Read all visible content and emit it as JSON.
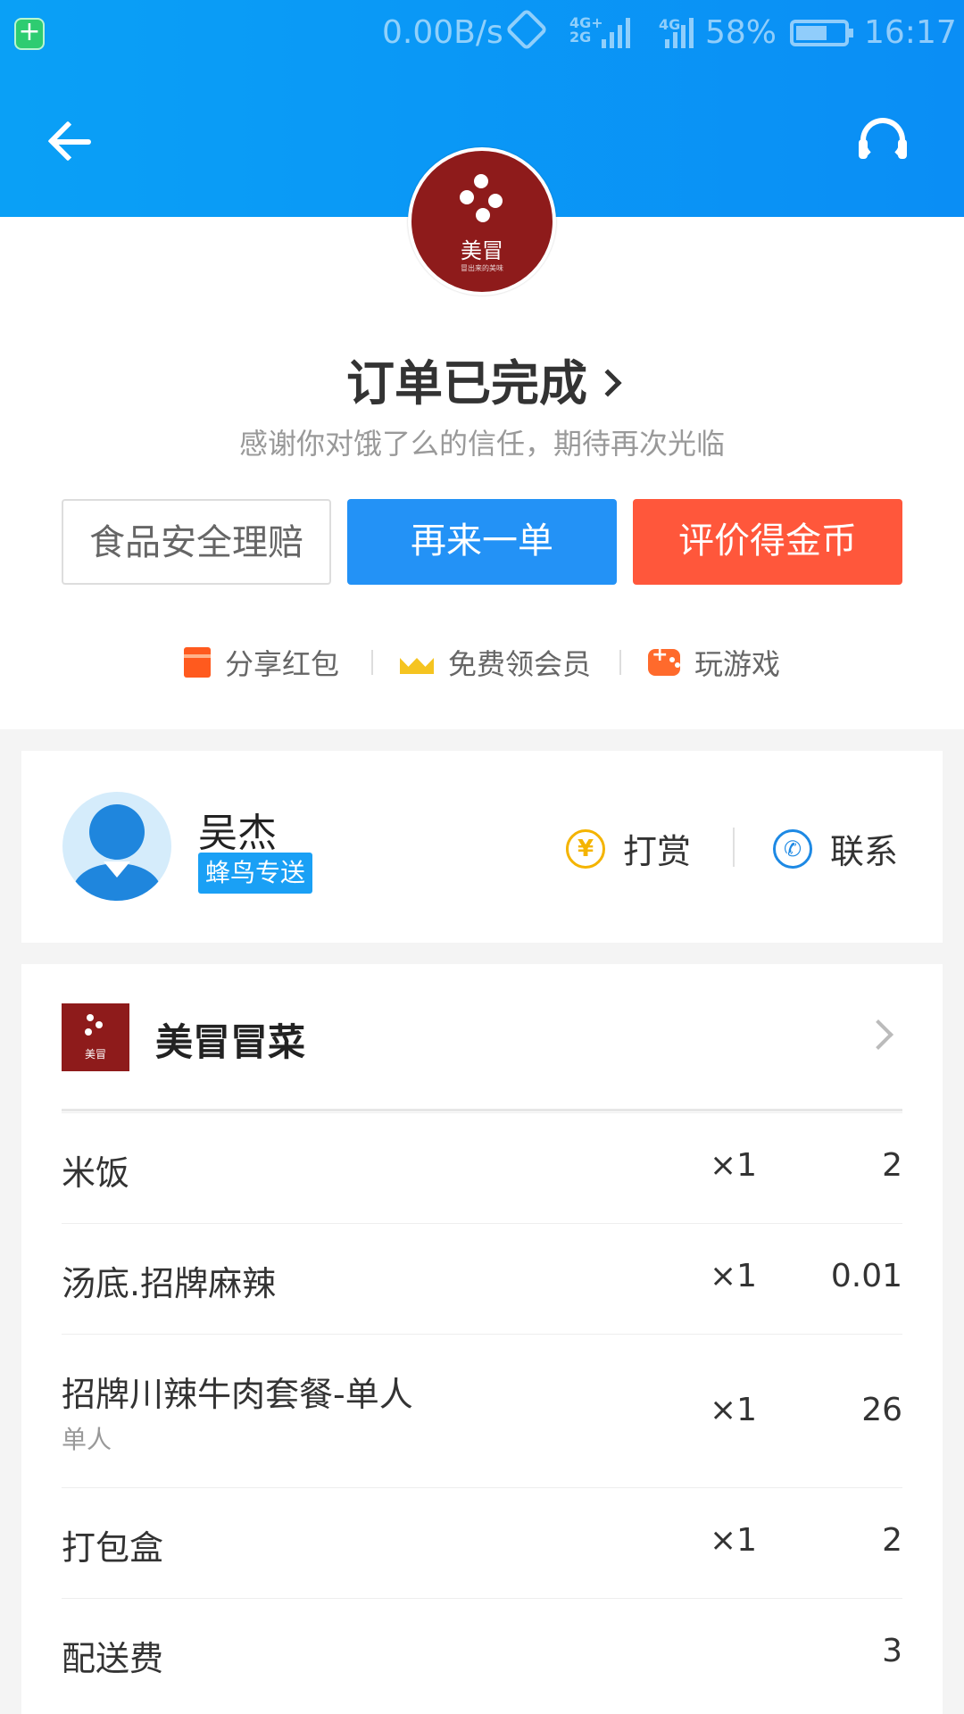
{
  "status_bar": {
    "net_speed": "0.00B/s",
    "sig1_label": "4G+\n2G",
    "sig2_label": "4G",
    "battery_pct": "58%",
    "battery_level": 0.58,
    "time": "16:17"
  },
  "header": {
    "back_icon": "arrow-left-icon",
    "support_icon": "headset-icon",
    "brand_color": "#0a9af5"
  },
  "restaurant_logo": {
    "name": "美冒",
    "tagline": "冒出来的美味"
  },
  "order_status": {
    "title": "订单已完成",
    "subtitle": "感谢你对饿了么的信任，期待再次光临"
  },
  "actions": {
    "food_safety": "食品安全理赔",
    "reorder": "再来一单",
    "rate": "评价得金币"
  },
  "extras": {
    "share": "分享红包",
    "vip": "免费领会员",
    "game": "玩游戏"
  },
  "rider": {
    "name": "吴杰",
    "tag": "蜂鸟专送",
    "tip_label": "打赏",
    "contact_label": "联系"
  },
  "shop": {
    "name": "美冒冒菜"
  },
  "items": [
    {
      "name": "米饭",
      "spec": "",
      "qty": "×1",
      "price": "2"
    },
    {
      "name": "汤底.招牌麻辣",
      "spec": "",
      "qty": "×1",
      "price": "0.01"
    },
    {
      "name": "招牌川辣牛肉套餐-单人",
      "spec": "单人",
      "qty": "×1",
      "price": "26"
    },
    {
      "name": "打包盒",
      "spec": "",
      "qty": "×1",
      "price": "2"
    },
    {
      "name": "配送费",
      "spec": "",
      "qty": "",
      "price": "3"
    }
  ],
  "colors": {
    "reorder_blue": "#2392f6",
    "rate_red": "#ff573b",
    "rider_tag_blue": "#1aa0f5",
    "logo_red": "#8e1b1b"
  }
}
